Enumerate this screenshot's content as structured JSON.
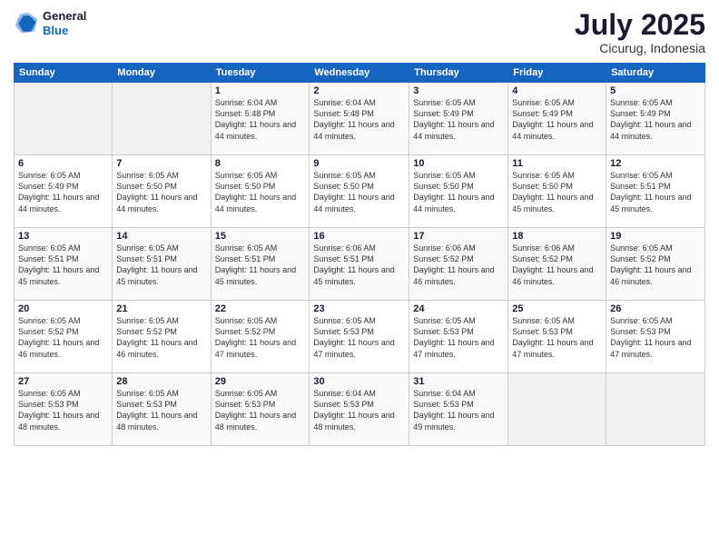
{
  "header": {
    "logo_line1": "General",
    "logo_line2": "Blue",
    "month": "July 2025",
    "location": "Cicurug, Indonesia"
  },
  "weekdays": [
    "Sunday",
    "Monday",
    "Tuesday",
    "Wednesday",
    "Thursday",
    "Friday",
    "Saturday"
  ],
  "weeks": [
    [
      {
        "day": "",
        "info": ""
      },
      {
        "day": "",
        "info": ""
      },
      {
        "day": "1",
        "info": "Sunrise: 6:04 AM\nSunset: 5:48 PM\nDaylight: 11 hours and 44 minutes."
      },
      {
        "day": "2",
        "info": "Sunrise: 6:04 AM\nSunset: 5:48 PM\nDaylight: 11 hours and 44 minutes."
      },
      {
        "day": "3",
        "info": "Sunrise: 6:05 AM\nSunset: 5:49 PM\nDaylight: 11 hours and 44 minutes."
      },
      {
        "day": "4",
        "info": "Sunrise: 6:05 AM\nSunset: 5:49 PM\nDaylight: 11 hours and 44 minutes."
      },
      {
        "day": "5",
        "info": "Sunrise: 6:05 AM\nSunset: 5:49 PM\nDaylight: 11 hours and 44 minutes."
      }
    ],
    [
      {
        "day": "6",
        "info": "Sunrise: 6:05 AM\nSunset: 5:49 PM\nDaylight: 11 hours and 44 minutes."
      },
      {
        "day": "7",
        "info": "Sunrise: 6:05 AM\nSunset: 5:50 PM\nDaylight: 11 hours and 44 minutes."
      },
      {
        "day": "8",
        "info": "Sunrise: 6:05 AM\nSunset: 5:50 PM\nDaylight: 11 hours and 44 minutes."
      },
      {
        "day": "9",
        "info": "Sunrise: 6:05 AM\nSunset: 5:50 PM\nDaylight: 11 hours and 44 minutes."
      },
      {
        "day": "10",
        "info": "Sunrise: 6:05 AM\nSunset: 5:50 PM\nDaylight: 11 hours and 44 minutes."
      },
      {
        "day": "11",
        "info": "Sunrise: 6:05 AM\nSunset: 5:50 PM\nDaylight: 11 hours and 45 minutes."
      },
      {
        "day": "12",
        "info": "Sunrise: 6:05 AM\nSunset: 5:51 PM\nDaylight: 11 hours and 45 minutes."
      }
    ],
    [
      {
        "day": "13",
        "info": "Sunrise: 6:05 AM\nSunset: 5:51 PM\nDaylight: 11 hours and 45 minutes."
      },
      {
        "day": "14",
        "info": "Sunrise: 6:05 AM\nSunset: 5:51 PM\nDaylight: 11 hours and 45 minutes."
      },
      {
        "day": "15",
        "info": "Sunrise: 6:05 AM\nSunset: 5:51 PM\nDaylight: 11 hours and 45 minutes."
      },
      {
        "day": "16",
        "info": "Sunrise: 6:06 AM\nSunset: 5:51 PM\nDaylight: 11 hours and 45 minutes."
      },
      {
        "day": "17",
        "info": "Sunrise: 6:06 AM\nSunset: 5:52 PM\nDaylight: 11 hours and 46 minutes."
      },
      {
        "day": "18",
        "info": "Sunrise: 6:06 AM\nSunset: 5:52 PM\nDaylight: 11 hours and 46 minutes."
      },
      {
        "day": "19",
        "info": "Sunrise: 6:05 AM\nSunset: 5:52 PM\nDaylight: 11 hours and 46 minutes."
      }
    ],
    [
      {
        "day": "20",
        "info": "Sunrise: 6:05 AM\nSunset: 5:52 PM\nDaylight: 11 hours and 46 minutes."
      },
      {
        "day": "21",
        "info": "Sunrise: 6:05 AM\nSunset: 5:52 PM\nDaylight: 11 hours and 46 minutes."
      },
      {
        "day": "22",
        "info": "Sunrise: 6:05 AM\nSunset: 5:52 PM\nDaylight: 11 hours and 47 minutes."
      },
      {
        "day": "23",
        "info": "Sunrise: 6:05 AM\nSunset: 5:53 PM\nDaylight: 11 hours and 47 minutes."
      },
      {
        "day": "24",
        "info": "Sunrise: 6:05 AM\nSunset: 5:53 PM\nDaylight: 11 hours and 47 minutes."
      },
      {
        "day": "25",
        "info": "Sunrise: 6:05 AM\nSunset: 5:53 PM\nDaylight: 11 hours and 47 minutes."
      },
      {
        "day": "26",
        "info": "Sunrise: 6:05 AM\nSunset: 5:53 PM\nDaylight: 11 hours and 47 minutes."
      }
    ],
    [
      {
        "day": "27",
        "info": "Sunrise: 6:05 AM\nSunset: 5:53 PM\nDaylight: 11 hours and 48 minutes."
      },
      {
        "day": "28",
        "info": "Sunrise: 6:05 AM\nSunset: 5:53 PM\nDaylight: 11 hours and 48 minutes."
      },
      {
        "day": "29",
        "info": "Sunrise: 6:05 AM\nSunset: 5:53 PM\nDaylight: 11 hours and 48 minutes."
      },
      {
        "day": "30",
        "info": "Sunrise: 6:04 AM\nSunset: 5:53 PM\nDaylight: 11 hours and 48 minutes."
      },
      {
        "day": "31",
        "info": "Sunrise: 6:04 AM\nSunset: 5:53 PM\nDaylight: 11 hours and 49 minutes."
      },
      {
        "day": "",
        "info": ""
      },
      {
        "day": "",
        "info": ""
      }
    ]
  ]
}
